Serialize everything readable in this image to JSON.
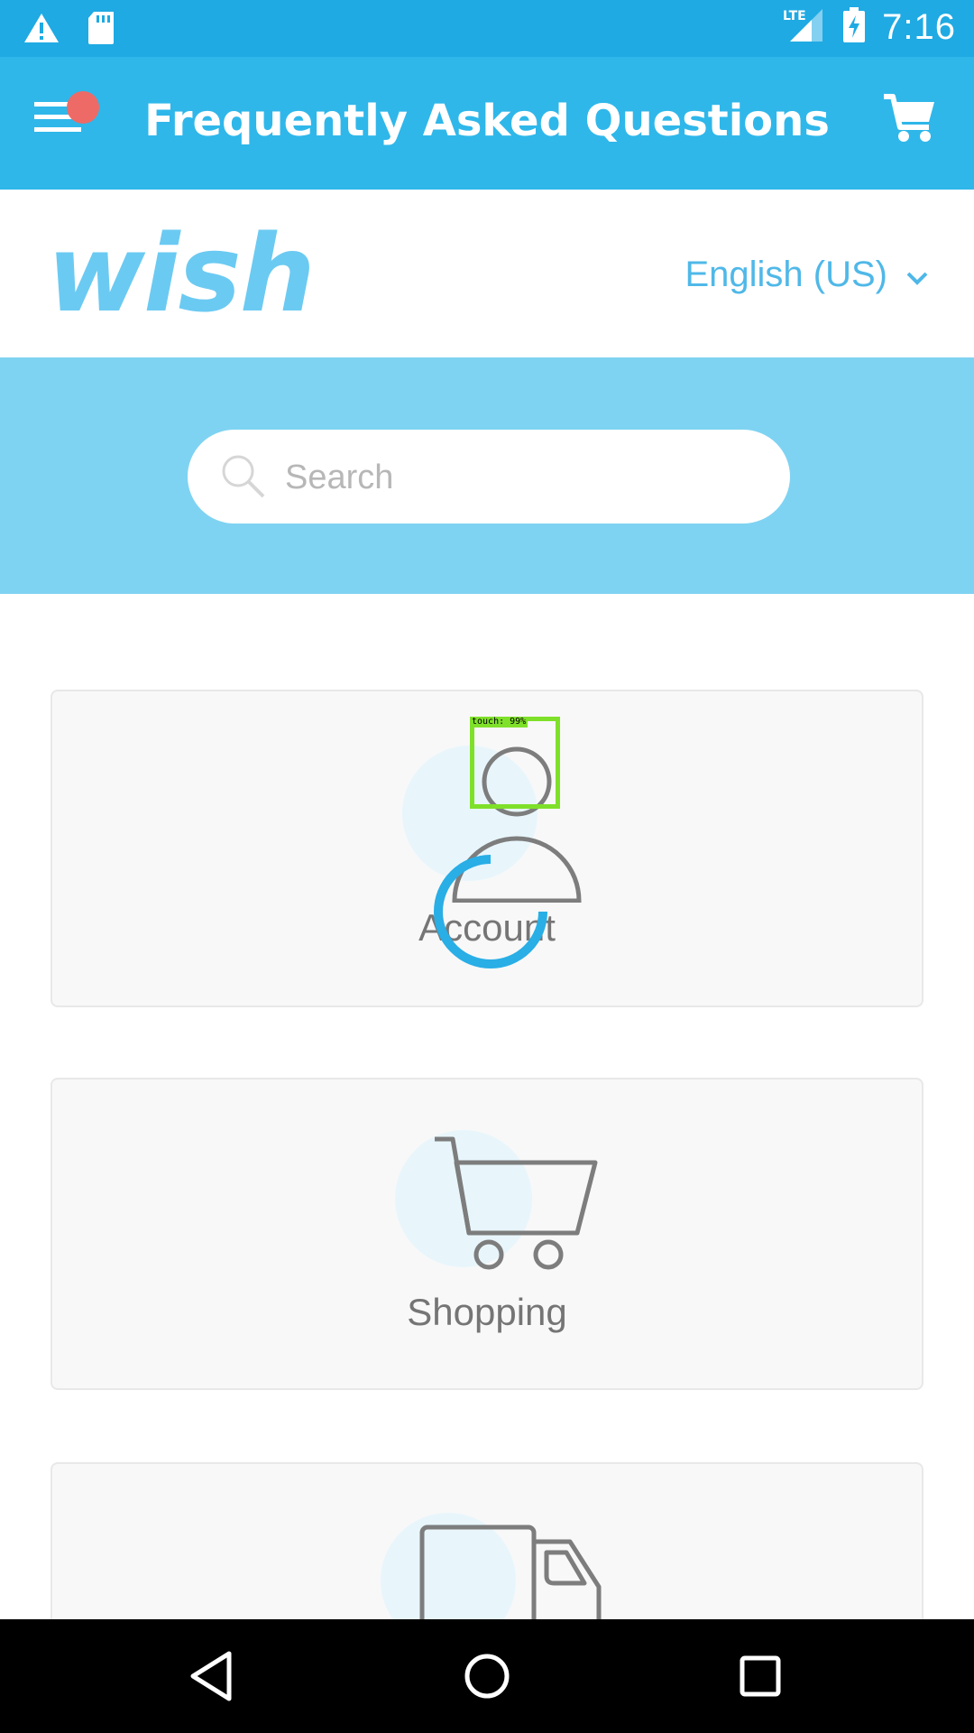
{
  "status_bar": {
    "time": "7:16",
    "network": "LTE",
    "icons": [
      "warning-icon",
      "sd-card-icon",
      "signal-icon",
      "battery-charging-icon"
    ]
  },
  "app_bar": {
    "title": "Frequently Asked Questions",
    "menu_icon": "hamburger-menu-icon",
    "cart_icon": "shopping-cart-icon"
  },
  "header": {
    "logo_text": "wish",
    "language": "English (US)"
  },
  "search": {
    "placeholder": "Search",
    "value": ""
  },
  "categories": [
    {
      "label": "Account",
      "icon": "user-icon"
    },
    {
      "label": "Shopping",
      "icon": "shopping-cart-icon"
    },
    {
      "label": "",
      "icon": "delivery-truck-icon"
    }
  ],
  "overlay": {
    "touch_label": "touch: 99%"
  },
  "colors": {
    "status_bar": "#1faae3",
    "app_bar": "#2fb7ea",
    "search_band": "#7fd3f2",
    "logo": "#6bcaf2",
    "accent": "#4fb8e8",
    "notification_dot": "#ee6a66",
    "touch_box": "#7fe02a"
  },
  "nav_bar": {
    "buttons": [
      "back-icon",
      "home-icon",
      "recents-icon"
    ]
  }
}
